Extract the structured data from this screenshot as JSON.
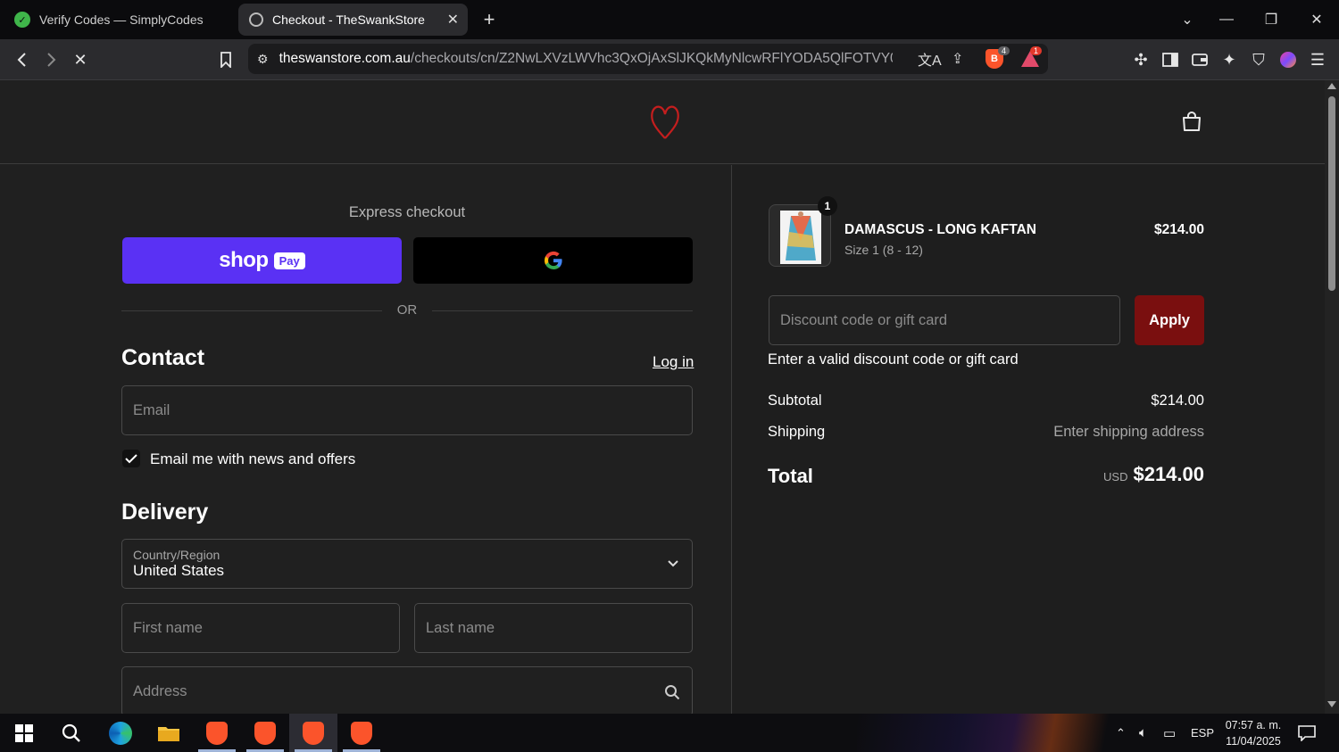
{
  "browser": {
    "tabs": [
      {
        "title": "Verify Codes — SimplyCodes",
        "active": false
      },
      {
        "title": "Checkout - TheSwankStore",
        "active": true
      }
    ],
    "new_tab_icon": "plus-icon",
    "url_host": "theswanstore.com.au",
    "url_path": "/checkouts/cn/Z2NwLXVzLWVhc3QxOjAxSlJKQkMyNlcwRFlYODA5QlFOTVY0N...",
    "brave_badge": "4",
    "rewards_badge": "1"
  },
  "store": {
    "logo_icon": "heart-logo-icon",
    "cart_icon": "shopping-bag-icon"
  },
  "checkout": {
    "express_label": "Express checkout",
    "shop_pay_text": "shop",
    "shop_pay_badge": "Pay",
    "or_label": "OR",
    "contact_heading": "Contact",
    "login_link": "Log in",
    "email_placeholder": "Email",
    "newsletter_label": "Email me with news and offers",
    "newsletter_checked": true,
    "delivery_heading": "Delivery",
    "country_label": "Country/Region",
    "country_value": "United States",
    "first_name_placeholder": "First name",
    "last_name_placeholder": "Last name",
    "address_placeholder": "Address"
  },
  "summary": {
    "item_name": "DAMASCUS - LONG KAFTAN",
    "item_variant": "Size 1 (8 - 12)",
    "item_qty": "1",
    "item_price": "$214.00",
    "discount_placeholder": "Discount code or gift card",
    "apply_label": "Apply",
    "discount_error": "Enter a valid discount code or gift card",
    "subtotal_label": "Subtotal",
    "subtotal_value": "$214.00",
    "shipping_label": "Shipping",
    "shipping_value": "Enter shipping address",
    "total_label": "Total",
    "total_currency": "USD",
    "total_value": "$214.00"
  },
  "taskbar": {
    "lang": "ESP",
    "time": "07:57 a. m.",
    "date": "11/04/2025"
  },
  "colors": {
    "shop_pay": "#5a31f4",
    "apply": "#7a0f0f",
    "accent_red": "#c41e1e"
  }
}
